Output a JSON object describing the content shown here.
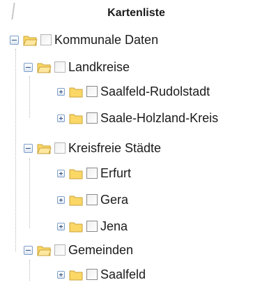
{
  "panel": {
    "title": "Kartenliste"
  },
  "tree": {
    "root": {
      "label": "Kommunale Daten",
      "expanded": true
    },
    "groups": [
      {
        "label": "Landkreise",
        "expanded": true,
        "children": [
          {
            "label": "Saalfeld-Rudolstadt",
            "expanded": false
          },
          {
            "label": "Saale-Holzland-Kreis",
            "expanded": false
          }
        ]
      },
      {
        "label": "Kreisfreie Städte",
        "expanded": true,
        "children": [
          {
            "label": "Erfurt",
            "expanded": false
          },
          {
            "label": "Gera",
            "expanded": false
          },
          {
            "label": "Jena",
            "expanded": false
          }
        ]
      },
      {
        "label": "Gemeinden",
        "expanded": true,
        "children": [
          {
            "label": "Saalfeld",
            "expanded": false
          }
        ]
      }
    ]
  },
  "colors": {
    "folder": "#fbd766",
    "folder_edge": "#c9a33a",
    "toggle_border": "#7e9fc9"
  }
}
